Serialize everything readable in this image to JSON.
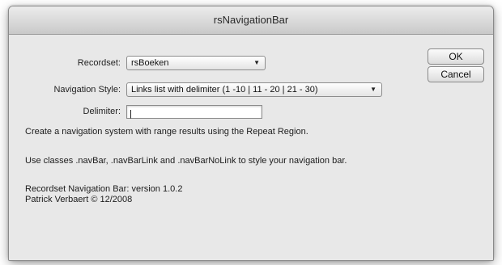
{
  "window": {
    "title": "rsNavigationBar"
  },
  "form": {
    "recordset_label": "Recordset:",
    "recordset_value": "rsBoeken",
    "nav_style_label": "Navigation Style:",
    "nav_style_value": "Links list with delimiter (1 -10 | 11 - 20 | 21 - 30)",
    "delimiter_label": "Delimiter:",
    "delimiter_value": "|"
  },
  "buttons": {
    "ok": "OK",
    "cancel": "Cancel"
  },
  "info": {
    "line1": "Create a navigation system with range results using the Repeat Region.",
    "line2": "Use classes .navBar, .navBarLink and .navBarNoLink to style your navigation bar.",
    "version": "Recordset Navigation Bar: version 1.0.2",
    "copyright": "Patrick Verbaert © 12/2008"
  }
}
